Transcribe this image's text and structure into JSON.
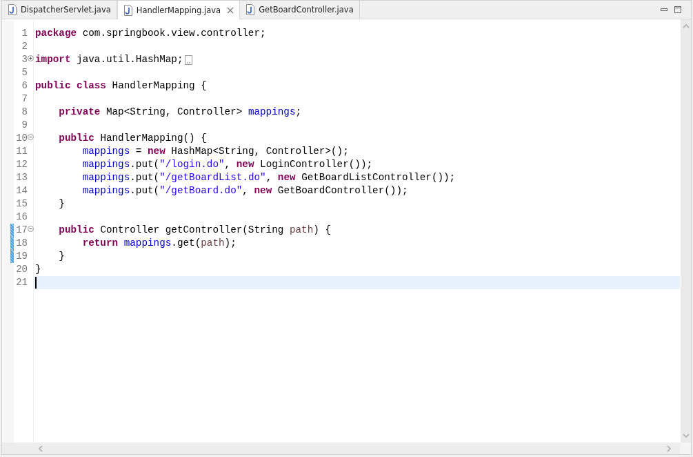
{
  "tabs": [
    {
      "label": "DispatcherServlet.java",
      "selected": false
    },
    {
      "label": "HandlerMapping.java",
      "selected": true
    },
    {
      "label": "GetBoardController.java",
      "selected": false
    }
  ],
  "editor": {
    "lines": [
      {
        "number": "1",
        "changed": false,
        "current": false,
        "tokens": [
          {
            "kind": "keyword",
            "text": "package"
          },
          {
            "kind": "plain",
            "text": " com.springbook.view.controller;"
          }
        ]
      },
      {
        "number": "2",
        "changed": false,
        "current": false
      },
      {
        "number": "3",
        "fold": {
          "collapsed": true
        },
        "changed": false,
        "current": false,
        "tokens": [
          {
            "kind": "keyword",
            "text": "import"
          },
          {
            "kind": "plain",
            "text": " java.util.HashMap;"
          }
        ]
      },
      {
        "number": "5",
        "changed": false,
        "current": false
      },
      {
        "number": "6",
        "changed": false,
        "current": false,
        "tokens": [
          {
            "kind": "keyword",
            "text": "public class"
          },
          {
            "kind": "plain",
            "text": " HandlerMapping {"
          }
        ]
      },
      {
        "number": "7",
        "changed": false,
        "current": false
      },
      {
        "number": "8",
        "changed": false,
        "current": false,
        "tokens": [
          {
            "kind": "keyword",
            "text": "    private"
          },
          {
            "kind": "plain",
            "text": " Map<String, Controller> "
          },
          {
            "kind": "field",
            "text": "mappings"
          },
          {
            "kind": "plain",
            "text": ";"
          }
        ]
      },
      {
        "number": "9",
        "changed": false,
        "current": false
      },
      {
        "number": "10",
        "fold": {
          "collapsed": false
        },
        "changed": false,
        "current": false,
        "tokens": [
          {
            "kind": "keyword",
            "text": "    public"
          },
          {
            "kind": "plain",
            "text": " HandlerMapping() {"
          }
        ]
      },
      {
        "number": "11",
        "changed": false,
        "current": false,
        "tokens": [
          {
            "kind": "field",
            "text": "        mappings"
          },
          {
            "kind": "plain",
            "text": " = "
          },
          {
            "kind": "keyword",
            "text": "new"
          },
          {
            "kind": "plain",
            "text": " HashMap<String, Controller>();"
          }
        ]
      },
      {
        "number": "12",
        "changed": false,
        "current": false,
        "tokens": [
          {
            "kind": "field",
            "text": "        mappings"
          },
          {
            "kind": "plain",
            "text": ".put("
          },
          {
            "kind": "string",
            "text": "\"/login.do\""
          },
          {
            "kind": "plain",
            "text": ", "
          },
          {
            "kind": "keyword",
            "text": "new"
          },
          {
            "kind": "plain",
            "text": " LoginController());"
          }
        ]
      },
      {
        "number": "13",
        "changed": false,
        "current": false,
        "tokens": [
          {
            "kind": "field",
            "text": "        mappings"
          },
          {
            "kind": "plain",
            "text": ".put("
          },
          {
            "kind": "string",
            "text": "\"/getBoardList.do\""
          },
          {
            "kind": "plain",
            "text": ", "
          },
          {
            "kind": "keyword",
            "text": "new"
          },
          {
            "kind": "plain",
            "text": " GetBoardListController());"
          }
        ]
      },
      {
        "number": "14",
        "changed": false,
        "current": false,
        "tokens": [
          {
            "kind": "field",
            "text": "        mappings"
          },
          {
            "kind": "plain",
            "text": ".put("
          },
          {
            "kind": "string",
            "text": "\"/getBoard.do\""
          },
          {
            "kind": "plain",
            "text": ", "
          },
          {
            "kind": "keyword",
            "text": "new"
          },
          {
            "kind": "plain",
            "text": " GetBoardController());"
          }
        ]
      },
      {
        "number": "15",
        "changed": false,
        "current": false,
        "tokens": [
          {
            "kind": "plain",
            "text": "    }"
          }
        ]
      },
      {
        "number": "16",
        "changed": false,
        "current": false
      },
      {
        "number": "17",
        "fold": {
          "collapsed": false
        },
        "changed": true,
        "current": false,
        "tokens": [
          {
            "kind": "keyword",
            "text": "    public"
          },
          {
            "kind": "plain",
            "text": " Controller getController(String "
          },
          {
            "kind": "param",
            "text": "path"
          },
          {
            "kind": "plain",
            "text": ") {"
          }
        ]
      },
      {
        "number": "18",
        "changed": true,
        "current": false,
        "tokens": [
          {
            "kind": "keyword",
            "text": "        return"
          },
          {
            "kind": "field",
            "text": " mappings"
          },
          {
            "kind": "plain",
            "text": ".get("
          },
          {
            "kind": "param",
            "text": "path"
          },
          {
            "kind": "plain",
            "text": ");"
          }
        ]
      },
      {
        "number": "19",
        "changed": true,
        "current": false,
        "tokens": [
          {
            "kind": "plain",
            "text": "    }"
          }
        ]
      },
      {
        "number": "20",
        "changed": false,
        "current": false,
        "tokens": [
          {
            "kind": "plain",
            "text": "}"
          }
        ]
      },
      {
        "number": "21",
        "changed": false,
        "current": true
      }
    ]
  }
}
